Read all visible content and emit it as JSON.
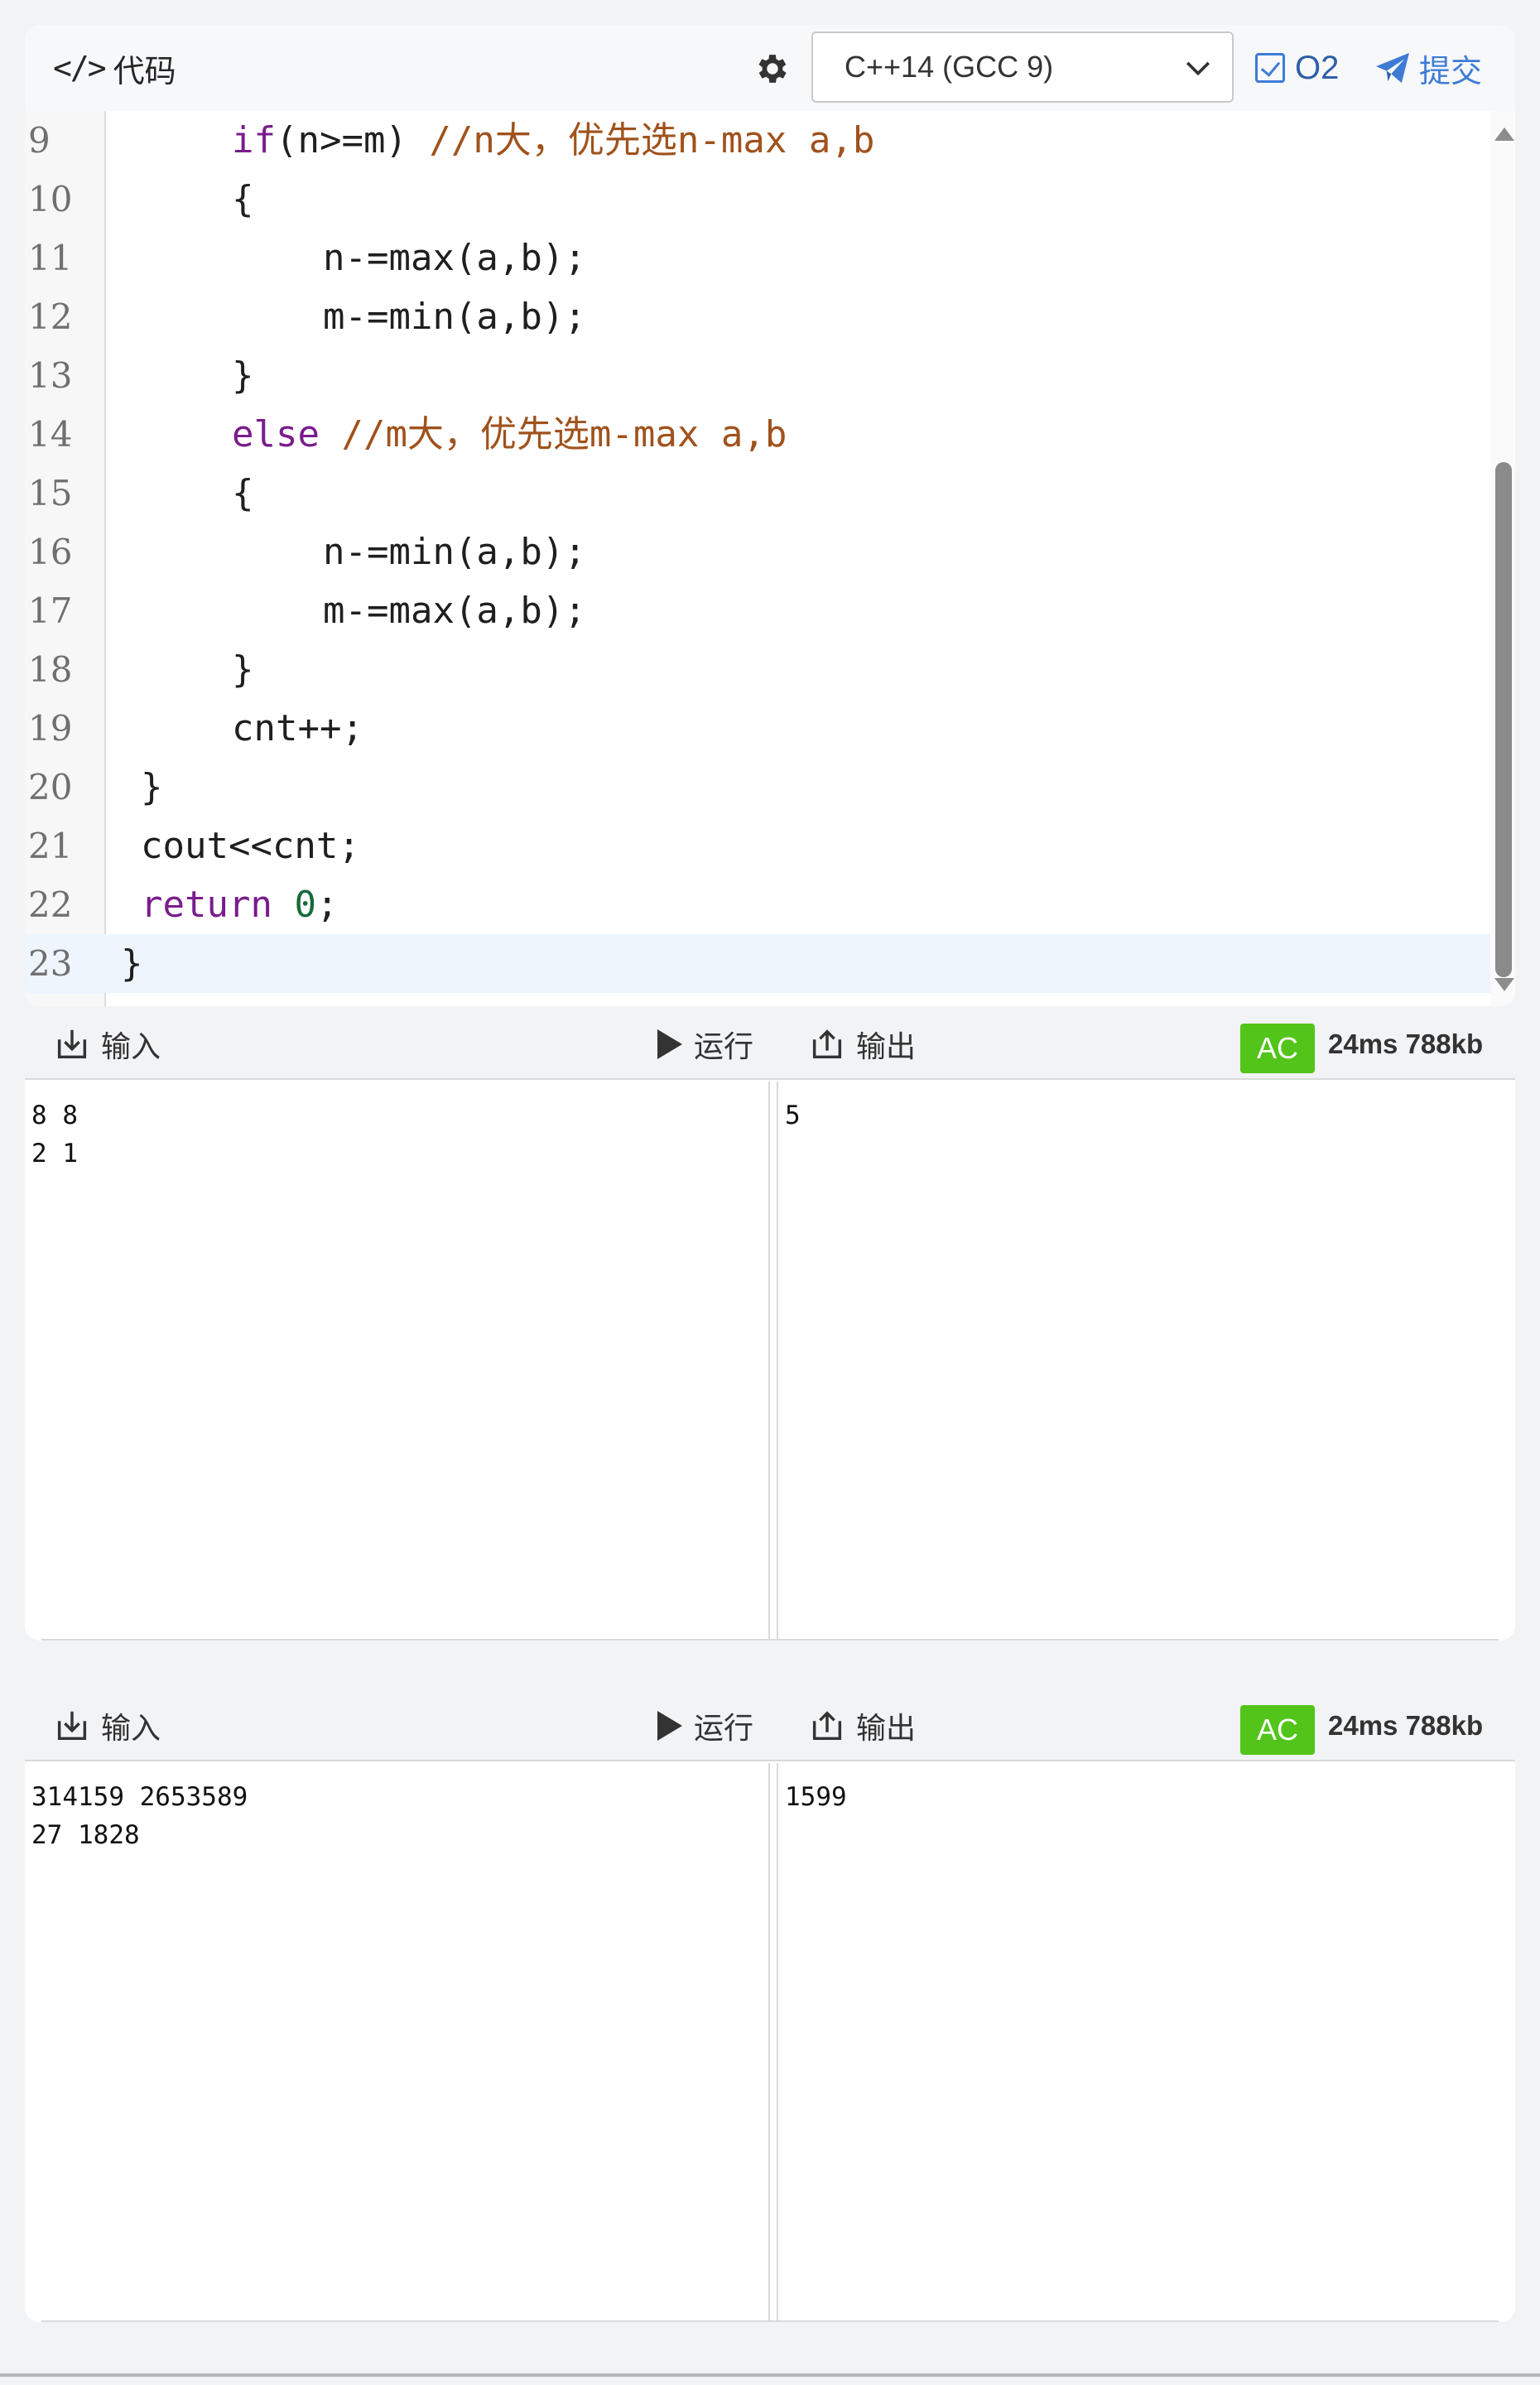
{
  "toolbar": {
    "title": "代码",
    "language": "C++14 (GCC 9)",
    "o2_label": "O2",
    "submit_label": "提交"
  },
  "code_lines": [
    {
      "num": "9"
    },
    {
      "num": "10"
    },
    {
      "num": "11"
    },
    {
      "num": "12"
    },
    {
      "num": "13"
    },
    {
      "num": "14"
    },
    {
      "num": "15"
    },
    {
      "num": "16"
    },
    {
      "num": "17"
    },
    {
      "num": "18"
    },
    {
      "num": "19"
    },
    {
      "num": "20"
    },
    {
      "num": "21"
    },
    {
      "num": "22"
    },
    {
      "num": "23"
    }
  ],
  "code_text": {
    "l9_kw": "if",
    "l9_code": "(n>=m) ",
    "l9_cm": "//n大，优先选n-max a,b",
    "l10": "{",
    "l11": "n-=max(a,b);",
    "l12": "m-=min(a,b);",
    "l13": "}",
    "l14_kw": "else",
    "l14_cm": " //m大，优先选m-max a,b",
    "l15": "{",
    "l16": "n-=min(a,b);",
    "l17": "m-=max(a,b);",
    "l18": "}",
    "l19": "cnt++;",
    "l20": "}",
    "l21": "cout<<cnt;",
    "l22_kw": "return",
    "l22_num": "0",
    "l22_end": ";",
    "l23": "}"
  },
  "panels": [
    {
      "input_label": "输入",
      "run_label": "运行",
      "output_label": "输出",
      "status": "AC",
      "stats": "24ms 788kb",
      "input_text": "8 8\n2 1",
      "output_text": "5"
    },
    {
      "input_label": "输入",
      "run_label": "运行",
      "output_label": "输出",
      "status": "AC",
      "stats": "24ms 788kb",
      "input_text": "314159 2653589\n27 1828",
      "output_text": "1599"
    }
  ],
  "colors": {
    "accent": "#3e7bd6",
    "ac_green": "#52c41a",
    "keyword": "#7a1c8c",
    "comment": "#a0521c",
    "number": "#166b3b"
  }
}
